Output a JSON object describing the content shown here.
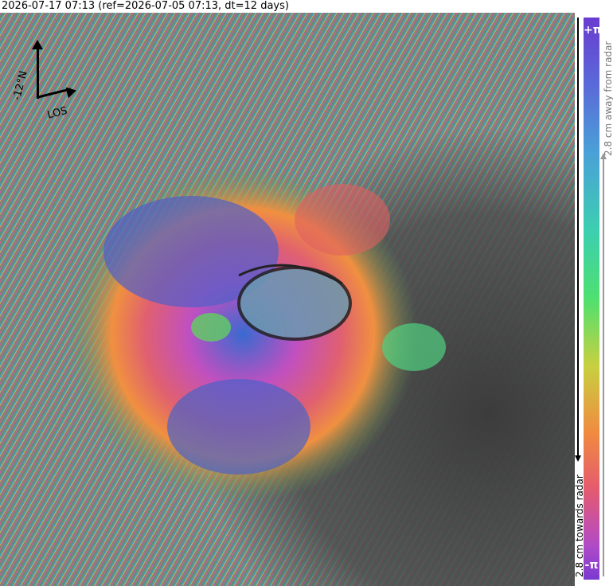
{
  "title": "2026-07-17 07:13 (ref=2026-07-05 07:13, dt=12 days)",
  "compass": {
    "north_label": "-12°N",
    "los_label": "LOS"
  },
  "colorbar": {
    "top_label": "+π",
    "bottom_label": "-π",
    "away_label": "2.8 cm away from radar",
    "towards_label": "2.8 cm towards radar",
    "colors": [
      "#6a3bd0",
      "#4aa0d8",
      "#3ccfb0",
      "#4ee070",
      "#c8d040",
      "#f08a40",
      "#e55a70",
      "#b04ac8"
    ]
  }
}
